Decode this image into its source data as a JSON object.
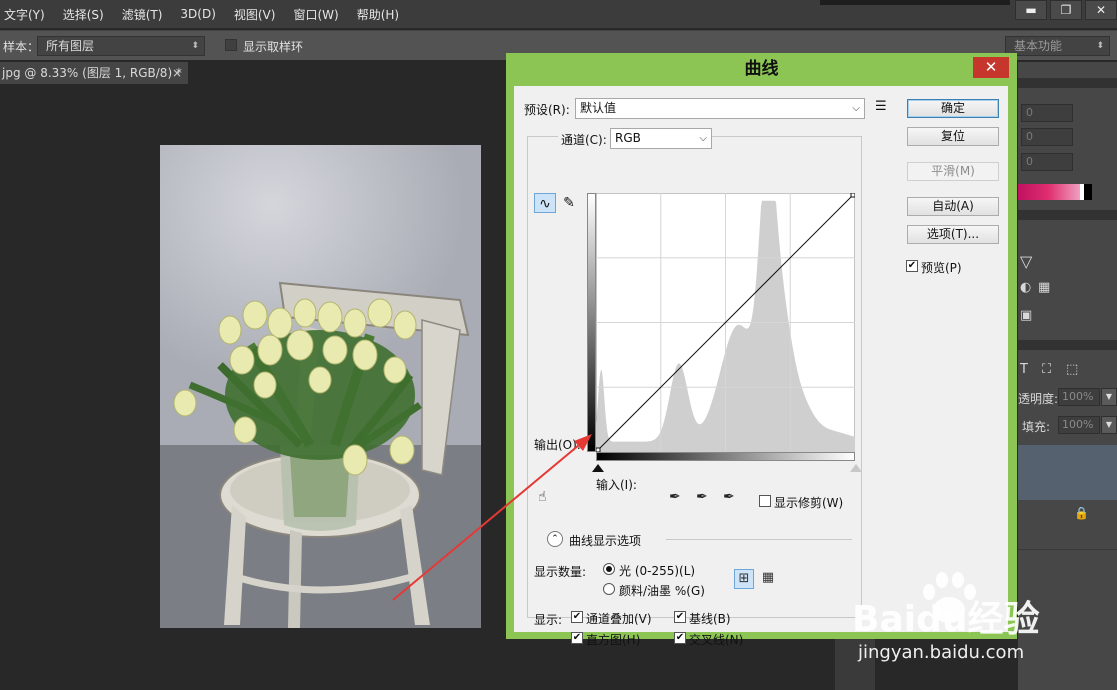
{
  "menubar": {
    "items": [
      "文字(Y)",
      "选择(S)",
      "滤镜(T)",
      "3D(D)",
      "视图(V)",
      "窗口(W)",
      "帮助(H)"
    ],
    "window_controls": [
      "▬",
      "❐",
      "✕"
    ]
  },
  "options": {
    "sample_label": "样本：",
    "sample_value": "所有图层",
    "show_ring_label": "显示取样环",
    "workspace": "基本功能"
  },
  "doc_tab": {
    "title": "jpg @ 8.33% (图层 1, RGB/8) *",
    "close": "×"
  },
  "right_panels": {
    "fields": [
      "0",
      "0",
      "0"
    ],
    "opacity_label": "透明度:",
    "opacity_value": "100%",
    "fill_label": "填充:",
    "fill_value": "100%",
    "text_icon": "T"
  },
  "dialog": {
    "title": "曲线",
    "close": "✕",
    "preset_label": "预设(R):",
    "preset_value": "默认值",
    "channel_label": "通道(C):",
    "channel_value": "RGB",
    "output_label": "输出(O):",
    "input_label": "输入(I):",
    "show_clipping_label": "显示修剪(W)",
    "curve_options_label": "曲线显示选项",
    "show_amount_label": "显示数量:",
    "light_label": "光 (0-255)(L)",
    "pigment_label": "颜料/油墨 %(G)",
    "show_label": "显示:",
    "channel_overlay_label": "通道叠加(V)",
    "baseline_label": "基线(B)",
    "histogram_label": "直方图(H)",
    "intersection_label": "交叉线(N)",
    "preview_label": "预览(P)",
    "buttons": {
      "ok": "确定",
      "reset": "复位",
      "smooth": "平滑(M)",
      "auto": "自动(A)",
      "options": "选项(T)..."
    }
  },
  "watermark": {
    "brand": "Baidu经验",
    "url": "jingyan.baidu.com"
  },
  "colors": {
    "dialog_frame": "#8cc553",
    "close_button": "#c7362d",
    "arrow": "#e53935",
    "ps_dark": "#282828",
    "ps_panel": "#535353"
  }
}
